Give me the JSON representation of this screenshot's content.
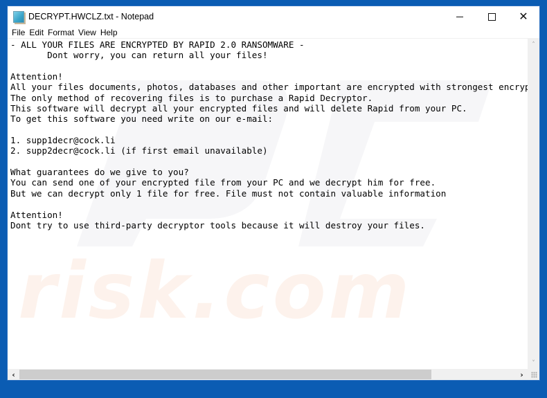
{
  "window": {
    "title": "DECRYPT.HWCLZ.txt - Notepad",
    "app_icon": "notepad-icon",
    "controls": {
      "minimize": "minimize-icon",
      "maximize": "maximize-icon",
      "close": "close-icon",
      "close_glyph": "✕"
    }
  },
  "menubar": {
    "items": [
      {
        "label": "File"
      },
      {
        "label": "Edit"
      },
      {
        "label": "Format"
      },
      {
        "label": "View"
      },
      {
        "label": "Help"
      }
    ]
  },
  "editor": {
    "lines": [
      "- ALL YOUR FILES ARE ENCRYPTED BY RAPID 2.0 RANSOMWARE -",
      "       Dont worry, you can return all your files!",
      "",
      "Attention!",
      "All your files documents, photos, databases and other important are encrypted with strongest encryption",
      "The only method of recovering files is to purchase a Rapid Decryptor.",
      "This software will decrypt all your encrypted files and will delete Rapid from your PC.",
      "To get this software you need write on our e-mail:",
      "",
      "1. supp1decr@cock.li",
      "2. supp2decr@cock.li (if first email unavailable)",
      "",
      "What guarantees do we give to you?",
      "You can send one of your encrypted file from your PC and we decrypt him for free.",
      "But we can decrypt only 1 file for free. File must not contain valuable information",
      "",
      "Attention!",
      "Dont try to use third-party decryptor tools because it will destroy your files."
    ],
    "watermark": "risk.com"
  },
  "scrollbars": {
    "vertical": {
      "up_glyph": "˄",
      "down_glyph": "˅"
    },
    "horizontal": {
      "left_glyph": "‹",
      "right_glyph": "›",
      "thumb_fraction": 0.83,
      "position_fraction": 0.0
    }
  },
  "colors": {
    "desktop_blue": "#0b5cb3",
    "watermark": "#fdf1ea",
    "scroll_track": "#f0f0f0",
    "scroll_thumb": "#cdcdcd"
  }
}
